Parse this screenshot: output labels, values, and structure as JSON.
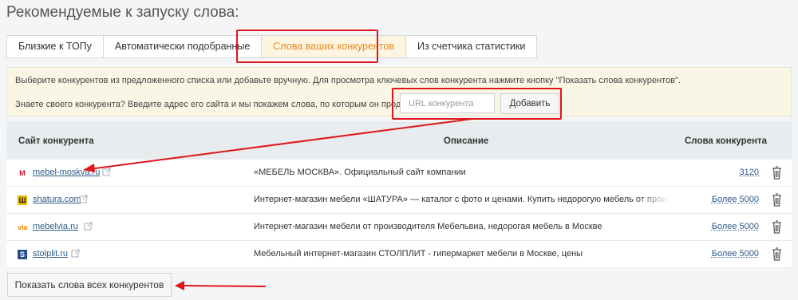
{
  "title": "Рекомендуемые к запуску слова:",
  "tabs": [
    {
      "label": "Близкие к ТОПу",
      "active": false
    },
    {
      "label": "Автоматически подобранные",
      "active": false
    },
    {
      "label": "Слова ваших конкурентов",
      "active": true
    },
    {
      "label": "Из счетчика статистики",
      "active": false
    }
  ],
  "info": {
    "line1": "Выберите конкурентов из предложенного списка или добавьте вручную. Для просмотра ключевых слов конкурента нажмите кнопку \"Показать слова конкурентов\".",
    "line2": "Знаете своего конкурента? Введите адрес его сайта и мы покажем слова, по которым он продвигается:",
    "url_placeholder": "URL конкурента",
    "add_label": "Добавить"
  },
  "table": {
    "headers": {
      "site": "Сайт конкурента",
      "description": "Описание",
      "words": "Слова конкурента"
    },
    "rows": [
      {
        "site": "mebel-moskva.ru",
        "description": "«МЕБЕЛЬ МОСКВА». Официальный сайт компании",
        "words": "3120",
        "favicon": "mebel-moskva-logo",
        "favicon_color": "#c8102e"
      },
      {
        "site": "shatura.com",
        "description": "Интернет-магазин мебели «ШАТУРА» — каталог с фото и ценами. Купить недорогую мебель от производителя в М",
        "words": "Более 5000",
        "favicon": "shatura-logo",
        "favicon_color": "#e6b800"
      },
      {
        "site": "mebelvia.ru",
        "description": "Интернет-магазин мебели от производителя Мебельвиа, недорогая мебель в Москве",
        "words": "Более 5000",
        "favicon": "mebelvia-logo",
        "favicon_color": "#f08c00"
      },
      {
        "site": "stolplit.ru",
        "description": "Мебельный интернет-магазин СТОЛПЛИТ - гипермаркет мебели в Москве, цены",
        "words": "Более 5000",
        "favicon": "stolplit-logo",
        "favicon_color": "#2a4d8f"
      }
    ]
  },
  "show_all_label": "Показать слова всех конкурентов",
  "colors": {
    "accent": "#e8891a",
    "highlight": "#e0161b",
    "link": "#2d5a87"
  }
}
